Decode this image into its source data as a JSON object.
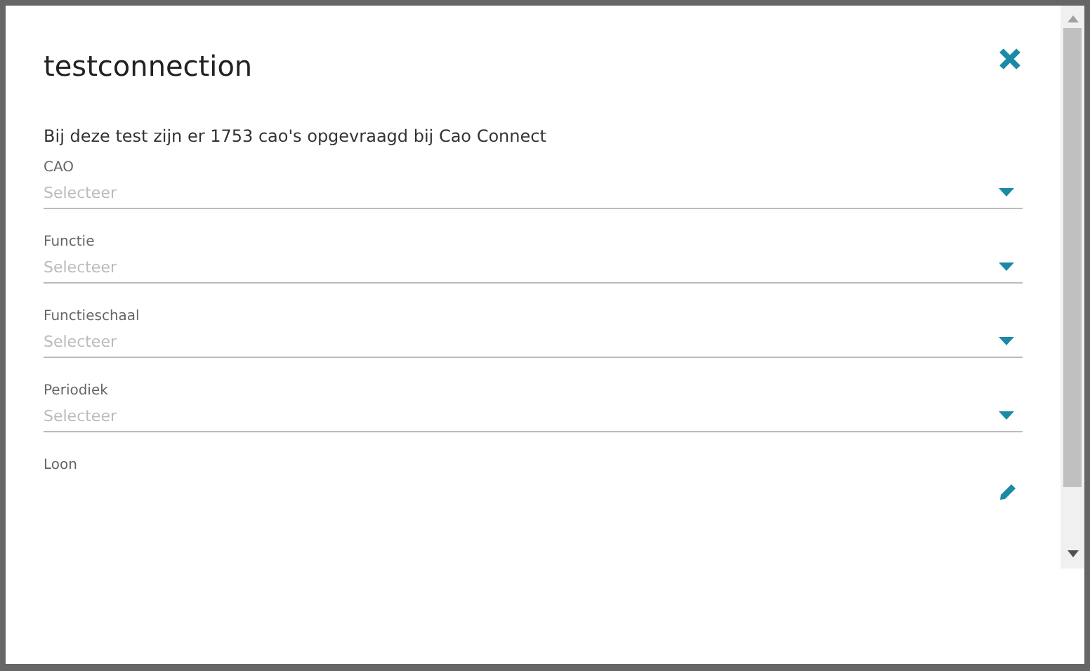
{
  "dialog": {
    "title": "testconnection",
    "intro": "Bij deze test zijn er 1753 cao's opgevraagd bij Cao Connect"
  },
  "fields": [
    {
      "kind": "select",
      "label": "CAO",
      "placeholder": "Selecteer"
    },
    {
      "kind": "select",
      "label": "Functie",
      "placeholder": "Selecteer"
    },
    {
      "kind": "select",
      "label": "Functieschaal",
      "placeholder": "Selecteer"
    },
    {
      "kind": "select",
      "label": "Periodiek",
      "placeholder": "Selecteer"
    },
    {
      "kind": "edit",
      "label": "Loon"
    }
  ]
}
